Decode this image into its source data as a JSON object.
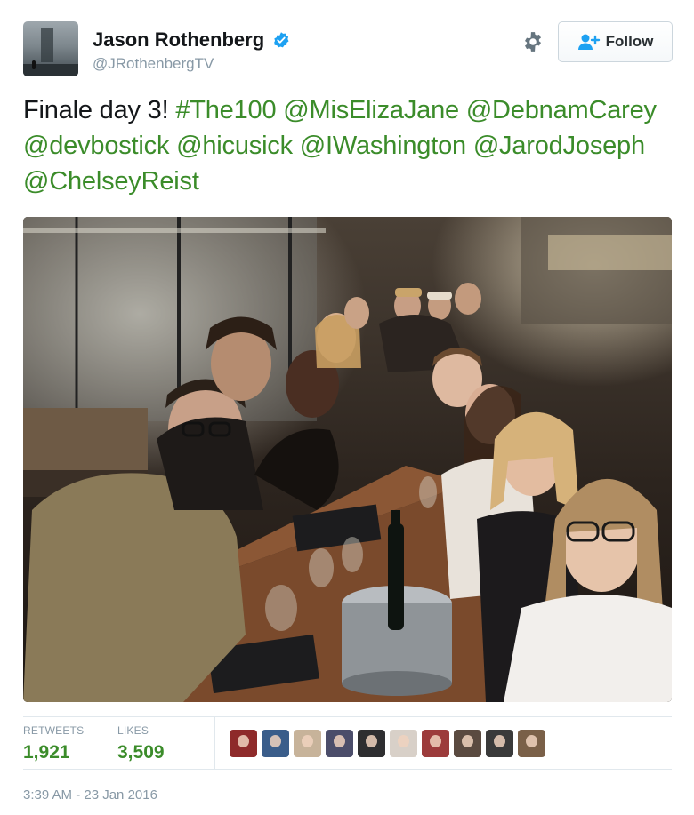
{
  "author": {
    "display_name": "Jason Rothenberg",
    "handle": "@JRothenbergTV",
    "verified": true,
    "avatar_icon": "profile-photo"
  },
  "actions": {
    "settings_icon": "gear-icon",
    "follow_label": "Follow",
    "follow_icon": "add-user-icon"
  },
  "tweet": {
    "segments": [
      {
        "text": "Finale day 3! ",
        "type": "plain"
      },
      {
        "text": "#The100",
        "type": "hashtag"
      },
      {
        "text": " ",
        "type": "plain"
      },
      {
        "text": "@MisElizaJane",
        "type": "mention"
      },
      {
        "text": " ",
        "type": "plain"
      },
      {
        "text": "@DebnamCarey",
        "type": "mention"
      },
      {
        "text": " ",
        "type": "plain"
      },
      {
        "text": "@devbostick",
        "type": "mention"
      },
      {
        "text": " ",
        "type": "plain"
      },
      {
        "text": "@hicusick",
        "type": "mention"
      },
      {
        "text": " ",
        "type": "plain"
      },
      {
        "text": "@IWashington",
        "type": "mention"
      },
      {
        "text": " ",
        "type": "plain"
      },
      {
        "text": "@JarodJoseph",
        "type": "mention"
      },
      {
        "text": " ",
        "type": "plain"
      },
      {
        "text": "@ChelseyReist",
        "type": "mention"
      }
    ],
    "media": "group-photo"
  },
  "stats": {
    "retweets_label": "RETWEETS",
    "retweets": "1,921",
    "likes_label": "LIKES",
    "likes": "3,509",
    "liker_count": 10
  },
  "timestamp": "3:39 AM - 23 Jan 2016",
  "colors": {
    "link": "#3b8c2a",
    "text": "#14171a",
    "muted": "#8899a6",
    "verified": "#1da1f2",
    "border": "#e1e8ed"
  }
}
